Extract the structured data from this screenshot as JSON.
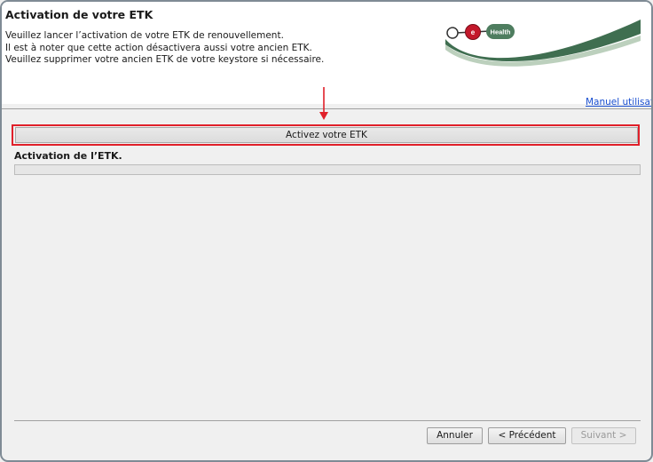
{
  "header": {
    "title": "Activation de votre ETK",
    "description": [
      "Veuillez lancer l’activation de votre ETK de renouvellement.",
      "Il est à noter que cette action désactivera aussi votre ancien ETK.",
      "Veuillez supprimer votre ancien ETK de votre keystore si nécessaire."
    ],
    "logo": {
      "letter": "e",
      "word": "Health"
    },
    "manual_link": "Manuel utilisateu"
  },
  "main": {
    "activate_button": "Activez votre ETK",
    "status_label": "Activation de l’ETK.",
    "progress": 0
  },
  "footer": {
    "cancel_label": "Annuler",
    "previous_label": "< Précédent",
    "next_label": "Suivant >",
    "next_enabled": false
  },
  "colors": {
    "highlight": "#e0202a",
    "logo_red": "#c3182b",
    "logo_green": "#4e7d5f",
    "link": "#1a4fd0"
  }
}
